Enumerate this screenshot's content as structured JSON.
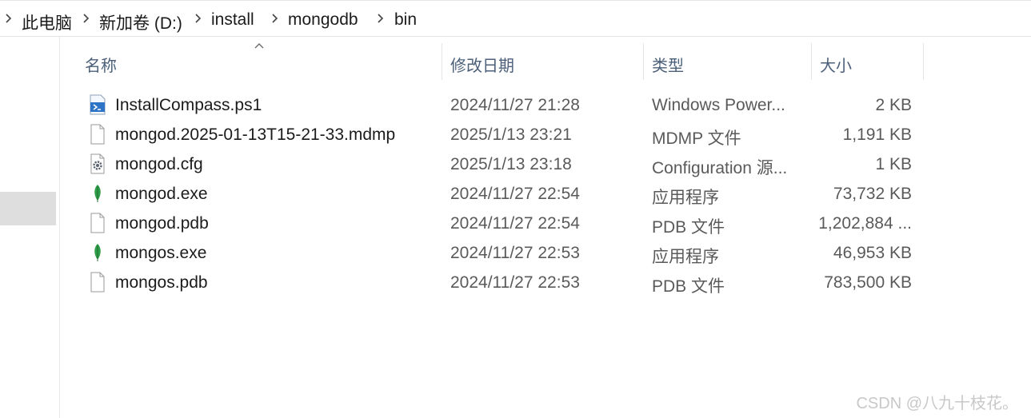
{
  "breadcrumb": [
    "此电脑",
    "新加卷 (D:)",
    "install",
    "mongodb",
    "bin"
  ],
  "columns": {
    "name": "名称",
    "modified": "修改日期",
    "type": "类型",
    "size": "大小"
  },
  "files": [
    {
      "name": "InstallCompass.ps1",
      "modified": "2024/11/27 21:28",
      "type": "Windows Power...",
      "size": "2 KB",
      "icon": "powershell-script-icon"
    },
    {
      "name": "mongod.2025-01-13T15-21-33.mdmp",
      "modified": "2025/1/13 23:21",
      "type": "MDMP 文件",
      "size": "1,191 KB",
      "icon": "blank-file-icon"
    },
    {
      "name": "mongod.cfg",
      "modified": "2025/1/13 23:18",
      "type": "Configuration 源...",
      "size": "1 KB",
      "icon": "config-file-icon"
    },
    {
      "name": "mongod.exe",
      "modified": "2024/11/27 22:54",
      "type": "应用程序",
      "size": "73,732 KB",
      "icon": "mongodb-leaf-icon"
    },
    {
      "name": "mongod.pdb",
      "modified": "2024/11/27 22:54",
      "type": "PDB 文件",
      "size": "1,202,884 ...",
      "icon": "blank-file-icon"
    },
    {
      "name": "mongos.exe",
      "modified": "2024/11/27 22:53",
      "type": "应用程序",
      "size": "46,953 KB",
      "icon": "mongodb-leaf-icon"
    },
    {
      "name": "mongos.pdb",
      "modified": "2024/11/27 22:53",
      "type": "PDB 文件",
      "size": "783,500 KB",
      "icon": "blank-file-icon"
    }
  ],
  "watermark": "CSDN @八九十枝花。"
}
